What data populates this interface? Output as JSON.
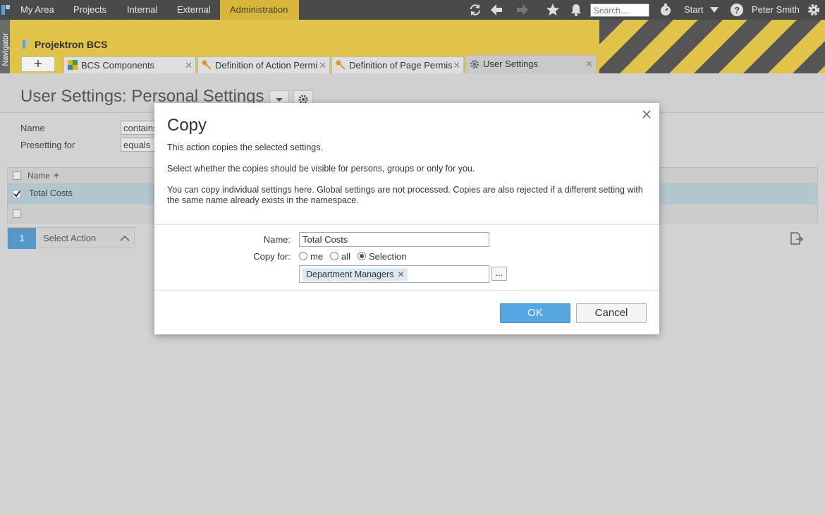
{
  "top_nav": {
    "items": [
      {
        "label": "My Area"
      },
      {
        "label": "Projects"
      },
      {
        "label": "Internal"
      },
      {
        "label": "External"
      },
      {
        "label": "Administration",
        "active": true
      }
    ],
    "search_placeholder": "Search...",
    "start_label": "Start",
    "user_name": "Peter Smith",
    "icons": [
      "apps-icon",
      "refresh-icon",
      "back-arrow-icon",
      "forward-arrow-icon",
      "star-icon",
      "bell-icon",
      "stopwatch-icon",
      "chevron-down-icon",
      "help-icon",
      "gear-icon"
    ]
  },
  "navigator_label": "Navigator",
  "app_title": "Projektron BCS",
  "tabs": [
    {
      "label": "BCS Components",
      "icon": "components-icon"
    },
    {
      "label": "Definition of Action Permi",
      "icon": "key-icon"
    },
    {
      "label": "Definition of Page Permiss",
      "icon": "key-icon"
    },
    {
      "label": "User Settings",
      "icon": "gear-icon",
      "active": true
    }
  ],
  "page": {
    "title": "User Settings: Personal Settings",
    "filters": [
      {
        "label": "Name",
        "operator": "contains"
      },
      {
        "label": "Presetting for",
        "operator": "equals"
      }
    ],
    "grid": {
      "column_header": "Name",
      "rows": [
        {
          "name": "Total Costs",
          "checked": true
        }
      ]
    },
    "step_number": "1",
    "step_label": "Select Action"
  },
  "dialog": {
    "title": "Copy",
    "paragraphs": [
      "This action copies the selected settings.",
      "Select whether the copies should be visible for persons, groups or only for you.",
      "You can copy individual settings here. Global settings are not processed. Copies are also rejected if a different setting with the same name already exists in the namespace."
    ],
    "name_label": "Name:",
    "name_value": "Total Costs",
    "copy_for_label": "Copy for:",
    "copy_for_options": [
      "me",
      "all",
      "Selection"
    ],
    "copy_for_selected": "Selection",
    "selection_chip": "Department Managers",
    "more_button": "...",
    "ok_label": "OK",
    "cancel_label": "Cancel"
  },
  "colors": {
    "topbar": "#4a4a4a",
    "accent_yellow": "#d9b63a",
    "primary_button": "#57a6e2",
    "selected_row": "#b2c6cf",
    "chip_bg": "#dbe9f3"
  }
}
